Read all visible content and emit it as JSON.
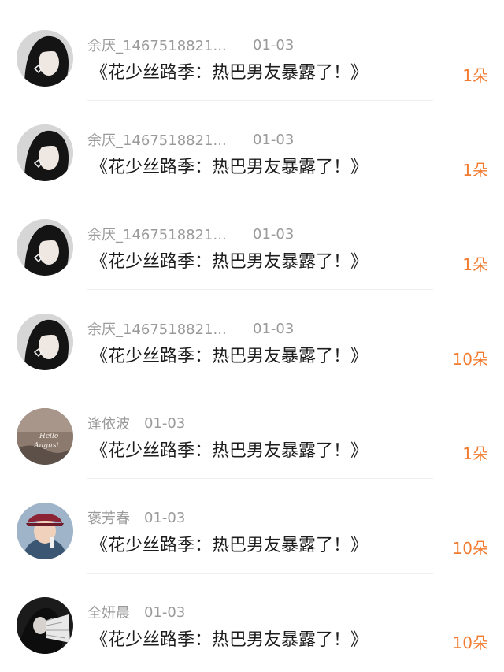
{
  "items": [
    {
      "username": "余厌_1467518821...",
      "date": "01-03",
      "message": "《花少丝路季：热巴男友暴露了！》",
      "count": "1朵",
      "avatar_icon": "dark-hair-girl-avatar"
    },
    {
      "username": "余厌_1467518821...",
      "date": "01-03",
      "message": "《花少丝路季：热巴男友暴露了！》",
      "count": "1朵",
      "avatar_icon": "dark-hair-girl-avatar"
    },
    {
      "username": "余厌_1467518821...",
      "date": "01-03",
      "message": "《花少丝路季：热巴男友暴露了！》",
      "count": "1朵",
      "avatar_icon": "dark-hair-girl-avatar"
    },
    {
      "username": "余厌_1467518821...",
      "date": "01-03",
      "message": "《花少丝路季：热巴男友暴露了！》",
      "count": "10朵",
      "avatar_icon": "dark-hair-girl-avatar"
    },
    {
      "username": "逢依波",
      "date": "01-03",
      "message": "《花少丝路季：热巴男友暴露了！》",
      "count": "1朵",
      "avatar_icon": "hello-august-avatar",
      "avatar_text_line1": "Hello",
      "avatar_text_line2": "August"
    },
    {
      "username": "褒芳春",
      "date": "01-03",
      "message": "《花少丝路季：热巴男友暴露了！》",
      "count": "10朵",
      "avatar_icon": "hat-person-avatar"
    },
    {
      "username": "全妍晨",
      "date": "01-03",
      "message": "《花少丝路季：热巴男友暴露了！》",
      "count": "10朵",
      "avatar_icon": "fan-girl-avatar"
    }
  ],
  "colors": {
    "count": "#f27b30",
    "meta": "#9a9a9a",
    "message": "#1d1d1d",
    "divider": "#efefef"
  }
}
